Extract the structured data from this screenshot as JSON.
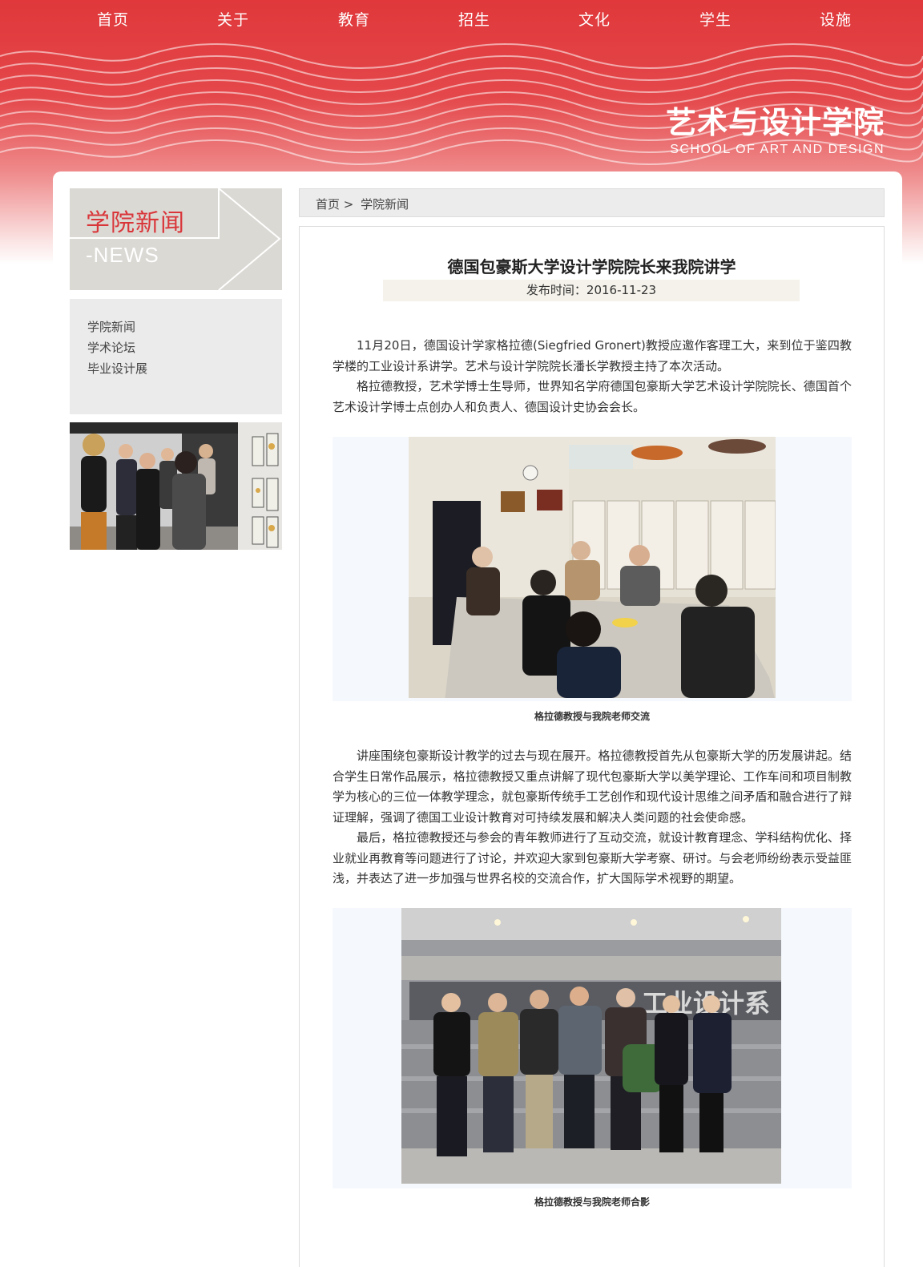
{
  "nav": {
    "items": [
      "首页",
      "关于",
      "教育",
      "招生",
      "文化",
      "学生",
      "设施"
    ]
  },
  "logo": {
    "cn": "艺术与设计学院",
    "en": "SCHOOL OF ART AND DESIGN"
  },
  "sidebar": {
    "title": "学院新闻",
    "subtitle": "-NEWS",
    "menu": [
      "学院新闻",
      "学术论坛",
      "毕业设计展"
    ]
  },
  "breadcrumb": {
    "home": "首页",
    "separator": ">",
    "current": "学院新闻"
  },
  "article": {
    "title": "德国包豪斯大学设计学院院长来我院讲学",
    "date_label": "发布时间：2016-11-23",
    "paragraphs": [
      "11月20日，德国设计学家格拉德(Siegfried Gronert)教授应邀作客理工大，来到位于鉴四教学楼的工业设计系讲学。艺术与设计学院院长潘长学教授主持了本次活动。",
      "格拉德教授，艺术学博士生导师，世界知名学府德国包豪斯大学艺术设计学院院长、德国首个艺术设计学博士点创办人和负责人、德国设计史协会会长。",
      "讲座围绕包豪斯设计教学的过去与现在展开。格拉德教授首先从包豪斯大学的历发展讲起。结合学生日常作品展示，格拉德教授又重点讲解了现代包豪斯大学以美学理论、工作车间和项目制教学为核心的三位一体教学理念，就包豪斯传统手工艺创作和现代设计思维之间矛盾和融合进行了辩证理解，强调了德国工业设计教育对可持续发展和解决人类问题的社会使命感。",
      "最后，格拉德教授还与参会的青年教师进行了互动交流，就设计教育理念、学科结构优化、择业就业再教育等问题进行了讨论，并欢迎大家到包豪斯大学考察、研讨。与会老师纷纷表示受益匪浅，并表达了进一步加强与世界名校的交流合作，扩大国际学术视野的期望。"
    ],
    "captions": [
      "格拉德教授与我院老师交流",
      "格拉德教授与我院老师合影"
    ],
    "photo2_wall_text": "工业设计系"
  },
  "colors": {
    "brand_red": "#e0383b",
    "sidebar_title_red": "#d9363a",
    "sidebar_head_bg": "#dbd9d4",
    "menu_bg": "#ebebeb"
  }
}
